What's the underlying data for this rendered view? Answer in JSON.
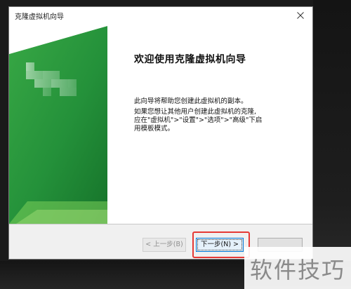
{
  "window": {
    "title": "克隆虚拟机向导",
    "close_icon": "close-icon"
  },
  "banner": {
    "colors": [
      "#2e9b3f",
      "#1d7d2c",
      "#7ccf5a"
    ]
  },
  "content": {
    "heading": "欢迎使用克隆虚拟机向导",
    "paragraph_1": "此向导将帮助您创建此虚拟机的副本。",
    "paragraph_2_line_1": "如果您想让其他用户创建此虚拟机的克隆,",
    "paragraph_2_line_2": "应在\"虚拟机\">\"设置\">\"选项\">\"高级\"下启",
    "paragraph_2_line_3": "用模板模式。"
  },
  "footer": {
    "back_label": "< 上一步(B)",
    "next_label": "下一步(N) >",
    "highlight_color": "#e53935"
  },
  "watermark": {
    "text": "软件技巧"
  }
}
